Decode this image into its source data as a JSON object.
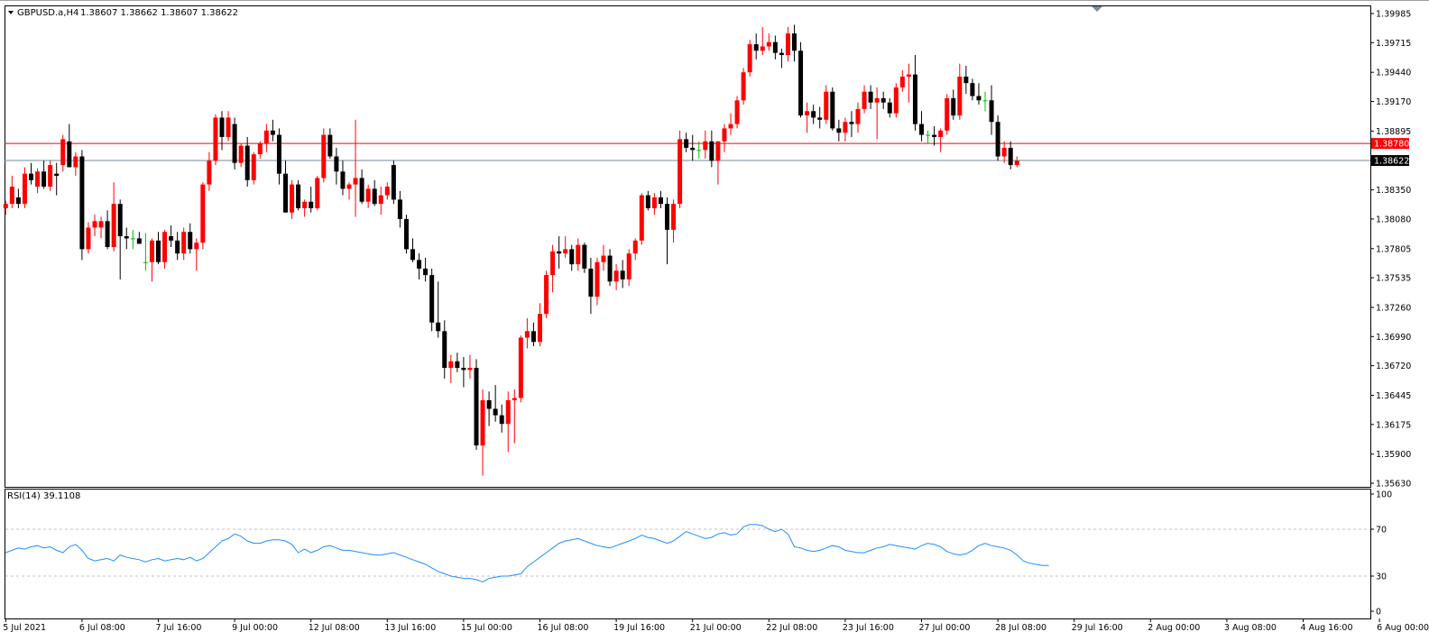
{
  "window": {
    "title": "GBPUSD.a,H4",
    "ohlc": "1.38607 1.38662 1.38607 1.38622"
  },
  "colors": {
    "up": "#ff0000",
    "down": "#000000",
    "doji": "#00c000",
    "frame": "#000000",
    "resistance_line": "#ff0000",
    "bid_line": "#778899",
    "rsi_line": "#1e90ff",
    "rsi_levels": "#c0c0c0",
    "bid_tag_bg": "#000000",
    "resistance_tag_bg": "#ff0000"
  },
  "chart_data": [
    {
      "type": "candlestick",
      "symbol": "GBPUSD.a",
      "timeframe": "H4",
      "ylim": [
        1.3563,
        1.39985
      ],
      "y_ticks": [
        "1.39985",
        "1.39715",
        "1.39440",
        "1.39170",
        "1.38895",
        "1.38350",
        "1.38080",
        "1.37805",
        "1.37535",
        "1.37260",
        "1.36990",
        "1.36720",
        "1.36445",
        "1.36175",
        "1.35900",
        "1.35630"
      ],
      "x_ticks": [
        "5 Jul 2021",
        "6 Jul 08:00",
        "7 Jul 16:00",
        "9 Jul 00:00",
        "12 Jul 08:00",
        "13 Jul 16:00",
        "15 Jul 00:00",
        "16 Jul 08:00",
        "19 Jul 16:00",
        "21 Jul 00:00",
        "22 Jul 08:00",
        "23 Jul 16:00",
        "27 Jul 00:00",
        "28 Jul 08:00",
        "29 Jul 16:00",
        "2 Aug 00:00",
        "3 Aug 08:00",
        "4 Aug 16:00",
        "6 Aug 00:00"
      ],
      "price_lines": [
        {
          "name": "resistance",
          "value": 1.3878,
          "label": "1.38780"
        },
        {
          "name": "bid",
          "value": 1.38622,
          "label": "1.38622"
        }
      ],
      "candles": [
        [
          1.3818,
          1.3825,
          1.3812,
          1.3822
        ],
        [
          1.3822,
          1.3848,
          1.3818,
          1.3838
        ],
        [
          1.3828,
          1.3836,
          1.3818,
          1.3822
        ],
        [
          1.3822,
          1.3856,
          1.3818,
          1.385
        ],
        [
          1.385,
          1.386,
          1.384,
          1.3844
        ],
        [
          1.3838,
          1.3855,
          1.3832,
          1.3852
        ],
        [
          1.3852,
          1.3862,
          1.3836,
          1.3838
        ],
        [
          1.3838,
          1.3862,
          1.3834,
          1.3858
        ],
        [
          1.385,
          1.386,
          1.383,
          1.3848
        ],
        [
          1.3858,
          1.3886,
          1.3852,
          1.3882
        ],
        [
          1.388,
          1.3896,
          1.386,
          1.3856
        ],
        [
          1.3856,
          1.387,
          1.3848,
          1.3866
        ],
        [
          1.3866,
          1.3872,
          1.377,
          1.378
        ],
        [
          1.378,
          1.3805,
          1.3776,
          1.38
        ],
        [
          1.38,
          1.3812,
          1.3792,
          1.3806
        ],
        [
          1.38,
          1.381,
          1.379,
          1.3806
        ],
        [
          1.3806,
          1.3816,
          1.378,
          1.3782
        ],
        [
          1.3782,
          1.3842,
          1.3778,
          1.3822
        ],
        [
          1.3822,
          1.3826,
          1.3752,
          1.3792
        ],
        [
          1.3792,
          1.38,
          1.378,
          1.379
        ],
        [
          1.379,
          1.3798,
          1.378,
          1.379
        ],
        [
          1.379,
          1.3796,
          1.3785,
          1.3785
        ],
        [
          1.3768,
          1.3795,
          1.376,
          1.3768
        ],
        [
          1.3768,
          1.379,
          1.375,
          1.3788
        ],
        [
          1.3788,
          1.3796,
          1.3766,
          1.3768
        ],
        [
          1.3768,
          1.3798,
          1.3762,
          1.3796
        ],
        [
          1.3792,
          1.3802,
          1.3782,
          1.3788
        ],
        [
          1.3788,
          1.3796,
          1.377,
          1.3776
        ],
        [
          1.3776,
          1.38,
          1.377,
          1.3796
        ],
        [
          1.3796,
          1.3804,
          1.3776,
          1.378
        ],
        [
          1.378,
          1.379,
          1.376,
          1.3786
        ],
        [
          1.3786,
          1.3842,
          1.378,
          1.384
        ],
        [
          1.384,
          1.387,
          1.3834,
          1.3862
        ],
        [
          1.3862,
          1.3905,
          1.3858,
          1.3902
        ],
        [
          1.3902,
          1.3908,
          1.3872,
          1.3884
        ],
        [
          1.3884,
          1.3908,
          1.388,
          1.3902
        ],
        [
          1.3896,
          1.3902,
          1.3854,
          1.386
        ],
        [
          1.386,
          1.3878,
          1.3856,
          1.3876
        ],
        [
          1.3876,
          1.3884,
          1.3838,
          1.3844
        ],
        [
          1.3844,
          1.387,
          1.384,
          1.3868
        ],
        [
          1.3868,
          1.388,
          1.3864,
          1.3878
        ],
        [
          1.3878,
          1.3896,
          1.387,
          1.389
        ],
        [
          1.389,
          1.39,
          1.388,
          1.3886
        ],
        [
          1.3886,
          1.3892,
          1.384,
          1.385
        ],
        [
          1.385,
          1.3862,
          1.3814,
          1.3814
        ],
        [
          1.3814,
          1.3844,
          1.3808,
          1.384
        ],
        [
          1.384,
          1.3844,
          1.3816,
          1.3818
        ],
        [
          1.3818,
          1.3826,
          1.381,
          1.3824
        ],
        [
          1.3824,
          1.3838,
          1.3814,
          1.3818
        ],
        [
          1.3818,
          1.3848,
          1.3816,
          1.3846
        ],
        [
          1.3846,
          1.3892,
          1.3842,
          1.3886
        ],
        [
          1.3886,
          1.3892,
          1.3864,
          1.3866
        ],
        [
          1.3866,
          1.3874,
          1.384,
          1.3852
        ],
        [
          1.3852,
          1.3862,
          1.383,
          1.3836
        ],
        [
          1.3836,
          1.3842,
          1.3826,
          1.384
        ],
        [
          1.384,
          1.39,
          1.381,
          1.3846
        ],
        [
          1.3846,
          1.3854,
          1.3822,
          1.3824
        ],
        [
          1.3824,
          1.384,
          1.3818,
          1.3836
        ],
        [
          1.3836,
          1.3844,
          1.382,
          1.3822
        ],
        [
          1.3822,
          1.3838,
          1.3812,
          1.383
        ],
        [
          1.383,
          1.3842,
          1.3826,
          1.3838
        ],
        [
          1.3858,
          1.3862,
          1.3822,
          1.3826
        ],
        [
          1.3826,
          1.3834,
          1.38,
          1.3808
        ],
        [
          1.3808,
          1.3812,
          1.3776,
          1.378
        ],
        [
          1.378,
          1.379,
          1.3768,
          1.377
        ],
        [
          1.377,
          1.3776,
          1.3752,
          1.3762
        ],
        [
          1.3762,
          1.3772,
          1.375,
          1.3756
        ],
        [
          1.3756,
          1.3762,
          1.3704,
          1.3712
        ],
        [
          1.3712,
          1.375,
          1.3698,
          1.3704
        ],
        [
          1.3704,
          1.3714,
          1.366,
          1.367
        ],
        [
          1.367,
          1.3682,
          1.3656,
          1.3676
        ],
        [
          1.3676,
          1.3684,
          1.3666,
          1.367
        ],
        [
          1.367,
          1.368,
          1.3652,
          1.3668
        ],
        [
          1.3668,
          1.3682,
          1.366,
          1.367
        ],
        [
          1.367,
          1.3678,
          1.3594,
          1.3598
        ],
        [
          1.3598,
          1.365,
          1.357,
          1.364
        ],
        [
          1.364,
          1.3648,
          1.3616,
          1.3632
        ],
        [
          1.3632,
          1.3654,
          1.362,
          1.3626
        ],
        [
          1.3626,
          1.3636,
          1.361,
          1.3618
        ],
        [
          1.3618,
          1.3648,
          1.3592,
          1.364
        ],
        [
          1.364,
          1.365,
          1.36,
          1.3642
        ],
        [
          1.3642,
          1.37,
          1.3638,
          1.3698
        ],
        [
          1.3698,
          1.3716,
          1.3688,
          1.3704
        ],
        [
          1.3704,
          1.3712,
          1.369,
          1.3694
        ],
        [
          1.3694,
          1.373,
          1.369,
          1.372
        ],
        [
          1.372,
          1.376,
          1.3716,
          1.3756
        ],
        [
          1.3756,
          1.3784,
          1.374,
          1.3778
        ],
        [
          1.3778,
          1.3792,
          1.3762,
          1.3776
        ],
        [
          1.3776,
          1.3792,
          1.3772,
          1.378
        ],
        [
          1.378,
          1.3784,
          1.376,
          1.3766
        ],
        [
          1.3766,
          1.379,
          1.376,
          1.3784
        ],
        [
          1.3784,
          1.3786,
          1.3758,
          1.3762
        ],
        [
          1.3762,
          1.3772,
          1.372,
          1.3736
        ],
        [
          1.3736,
          1.3772,
          1.3728,
          1.3768
        ],
        [
          1.3768,
          1.3784,
          1.376,
          1.3774
        ],
        [
          1.3774,
          1.378,
          1.3746,
          1.375
        ],
        [
          1.375,
          1.3766,
          1.3742,
          1.376
        ],
        [
          1.376,
          1.377,
          1.3744,
          1.3752
        ],
        [
          1.3752,
          1.378,
          1.3746,
          1.3776
        ],
        [
          1.3776,
          1.379,
          1.377,
          1.3788
        ],
        [
          1.3788,
          1.3832,
          1.3784,
          1.383
        ],
        [
          1.383,
          1.3834,
          1.3816,
          1.3818
        ],
        [
          1.3818,
          1.3832,
          1.3812,
          1.3828
        ],
        [
          1.3828,
          1.3834,
          1.3818,
          1.3822
        ],
        [
          1.3822,
          1.3828,
          1.3766,
          1.3798
        ],
        [
          1.3798,
          1.3826,
          1.3786,
          1.3822
        ],
        [
          1.3822,
          1.389,
          1.3818,
          1.3882
        ],
        [
          1.3882,
          1.3888,
          1.387,
          1.3874
        ],
        [
          1.3874,
          1.3886,
          1.3862,
          1.3872
        ],
        [
          1.3872,
          1.388,
          1.3864,
          1.3872
        ],
        [
          1.3872,
          1.389,
          1.3864,
          1.388
        ],
        [
          1.388,
          1.389,
          1.3856,
          1.3862
        ],
        [
          1.3862,
          1.388,
          1.384,
          1.388
        ],
        [
          1.388,
          1.3896,
          1.387,
          1.3892
        ],
        [
          1.3892,
          1.3906,
          1.3886,
          1.3896
        ],
        [
          1.3896,
          1.3922,
          1.3892,
          1.3918
        ],
        [
          1.3918,
          1.3948,
          1.3914,
          1.3944
        ],
        [
          1.3944,
          1.3974,
          1.394,
          1.397
        ],
        [
          1.397,
          1.398,
          1.3956,
          1.3964
        ],
        [
          1.3964,
          1.3986,
          1.396,
          1.3968
        ],
        [
          1.3968,
          1.398,
          1.3964,
          1.3972
        ],
        [
          1.3972,
          1.3978,
          1.3956,
          1.3962
        ],
        [
          1.3962,
          1.3966,
          1.3948,
          1.396
        ],
        [
          1.396,
          1.3986,
          1.3954,
          1.398
        ],
        [
          1.398,
          1.3988,
          1.3954,
          1.3964
        ],
        [
          1.3964,
          1.3972,
          1.3902,
          1.3904
        ],
        [
          1.3904,
          1.3916,
          1.3888,
          1.3908
        ],
        [
          1.3908,
          1.3914,
          1.3896,
          1.3902
        ],
        [
          1.3902,
          1.3912,
          1.3892,
          1.39
        ],
        [
          1.39,
          1.3932,
          1.3896,
          1.3926
        ],
        [
          1.3926,
          1.393,
          1.389,
          1.3892
        ],
        [
          1.3892,
          1.39,
          1.388,
          1.3888
        ],
        [
          1.3888,
          1.3902,
          1.388,
          1.3898
        ],
        [
          1.3898,
          1.3908,
          1.3884,
          1.3896
        ],
        [
          1.3896,
          1.3916,
          1.3888,
          1.391
        ],
        [
          1.391,
          1.3932,
          1.3906,
          1.3926
        ],
        [
          1.3926,
          1.3932,
          1.391,
          1.3916
        ],
        [
          1.3916,
          1.393,
          1.3882,
          1.392
        ],
        [
          1.392,
          1.3926,
          1.391,
          1.3916
        ],
        [
          1.3916,
          1.392,
          1.3902,
          1.3906
        ],
        [
          1.3906,
          1.3934,
          1.3902,
          1.393
        ],
        [
          1.393,
          1.3946,
          1.3926,
          1.394
        ],
        [
          1.394,
          1.3952,
          1.3916,
          1.3942
        ],
        [
          1.3942,
          1.396,
          1.389,
          1.3896
        ],
        [
          1.3896,
          1.3908,
          1.388,
          1.3886
        ],
        [
          1.3886,
          1.389,
          1.3878,
          1.3886
        ],
        [
          1.3886,
          1.3894,
          1.3876,
          1.3884
        ],
        [
          1.3884,
          1.3892,
          1.387,
          1.389
        ],
        [
          1.389,
          1.3924,
          1.3886,
          1.392
        ],
        [
          1.392,
          1.3928,
          1.39,
          1.3904
        ],
        [
          1.3904,
          1.3952,
          1.39,
          1.394
        ],
        [
          1.394,
          1.395,
          1.3924,
          1.3934
        ],
        [
          1.3934,
          1.3938,
          1.3918,
          1.3922
        ],
        [
          1.3922,
          1.3934,
          1.3914,
          1.3918
        ],
        [
          1.3918,
          1.3926,
          1.3908,
          1.3918
        ],
        [
          1.3918,
          1.3932,
          1.3886,
          1.3898
        ],
        [
          1.3898,
          1.3904,
          1.3862,
          1.3866
        ],
        [
          1.3866,
          1.388,
          1.386,
          1.3874
        ],
        [
          1.3874,
          1.388,
          1.3854,
          1.3858
        ],
        [
          1.3858,
          1.3866,
          1.3856,
          1.3862
        ]
      ]
    },
    {
      "type": "line",
      "title": "RSI(14) 39.1108",
      "ylim": [
        0,
        100
      ],
      "y_ticks": [
        "100",
        "70",
        "30",
        "0"
      ],
      "levels": [
        70,
        30
      ],
      "values": [
        50,
        52,
        54,
        53,
        55,
        56,
        54,
        55,
        52,
        50,
        55,
        57,
        52,
        45,
        43,
        44,
        45,
        43,
        48,
        46,
        45,
        44,
        42,
        44,
        45,
        43,
        44,
        45,
        44,
        46,
        43,
        45,
        50,
        55,
        60,
        62,
        66,
        64,
        60,
        58,
        58,
        60,
        61,
        61,
        60,
        57,
        50,
        53,
        50,
        52,
        55,
        56,
        54,
        52,
        52,
        51,
        50,
        49,
        48,
        48,
        49,
        50,
        48,
        46,
        44,
        42,
        40,
        37,
        34,
        32,
        30,
        29,
        28,
        28,
        27,
        25,
        28,
        29,
        30,
        30,
        31,
        32,
        38,
        42,
        46,
        50,
        54,
        58,
        60,
        61,
        62,
        60,
        58,
        56,
        55,
        54,
        56,
        58,
        60,
        62,
        65,
        63,
        62,
        60,
        58,
        60,
        64,
        68,
        66,
        64,
        62,
        63,
        66,
        67,
        65,
        66,
        72,
        74,
        74,
        73,
        70,
        68,
        70,
        66,
        55,
        54,
        52,
        51,
        52,
        54,
        56,
        55,
        52,
        51,
        50,
        50,
        52,
        54,
        55,
        57,
        56,
        55,
        54,
        53,
        56,
        58,
        57,
        55,
        51,
        49,
        48,
        49,
        52,
        56,
        58,
        56,
        55,
        54,
        52,
        48,
        43,
        41,
        40,
        39,
        39
      ]
    }
  ]
}
